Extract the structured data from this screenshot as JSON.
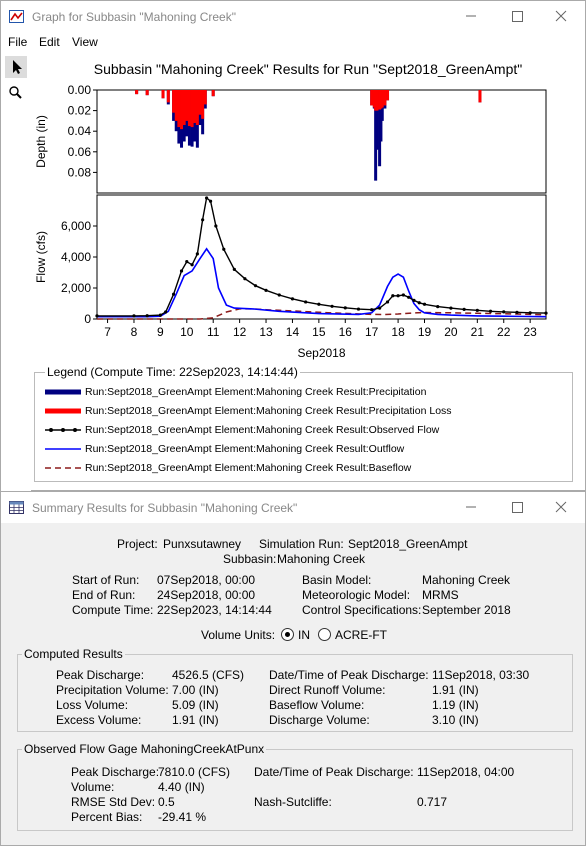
{
  "graph_window": {
    "title": "Graph for Subbasin \"Mahoning Creek\"",
    "menu": [
      "File",
      "Edit",
      "View"
    ],
    "tools": [
      "pointer-tool",
      "zoom-tool"
    ]
  },
  "plot": {
    "title": "Subbasin \"Mahoning Creek\" Results for Run \"Sept2018_GreenAmpt\"",
    "depth_ylabel": "Depth (in)",
    "depth_ticks": [
      "0.00",
      "0.02",
      "0.04",
      "0.06",
      "0.08"
    ],
    "flow_ylabel": "Flow (cfs)",
    "flow_ticks": [
      "0",
      "2,000",
      "4,000",
      "6,000"
    ],
    "x_ticks": [
      "7",
      "8",
      "9",
      "10",
      "11",
      "12",
      "13",
      "14",
      "15",
      "16",
      "17",
      "18",
      "19",
      "20",
      "21",
      "22",
      "23"
    ],
    "x_label": "Sep2018"
  },
  "chart_data": {
    "type": "line",
    "title": "Subbasin \"Mahoning Creek\" Results for Run \"Sept2018_GreenAmpt\"",
    "xlabel": "Sep2018",
    "xlim": [
      6.6,
      23.6
    ],
    "panels": [
      {
        "ylabel": "Depth (in)",
        "ylim": [
          0.0,
          0.1
        ],
        "inverted": true,
        "series": [
          {
            "name": "Run:Sept2018_GreenAmpt Element:Mahoning Creek Result:Precipitation",
            "color": "#000080",
            "x": [
              8.1,
              8.5,
              9.1,
              9.3,
              9.5,
              9.6,
              9.7,
              9.8,
              9.9,
              10.0,
              10.1,
              10.2,
              10.3,
              10.4,
              10.5,
              10.6,
              10.7,
              11.0,
              17.0,
              17.1,
              17.15,
              17.2,
              17.3,
              17.35,
              17.4,
              17.5,
              17.6,
              21.1
            ],
            "values": [
              0.004,
              0.005,
              0.008,
              0.014,
              0.03,
              0.04,
              0.052,
              0.056,
              0.05,
              0.045,
              0.054,
              0.055,
              0.05,
              0.056,
              0.034,
              0.043,
              0.018,
              0.006,
              0.015,
              0.018,
              0.088,
              0.058,
              0.074,
              0.05,
              0.03,
              0.018,
              0.01,
              0.012
            ]
          },
          {
            "name": "Run:Sept2018_GreenAmpt Element:Mahoning Creek Result:Precipitation Loss",
            "color": "#ff0000",
            "x": [
              8.1,
              8.5,
              9.1,
              9.3,
              9.5,
              9.6,
              9.7,
              9.8,
              9.9,
              10.0,
              10.1,
              10.2,
              10.3,
              10.4,
              10.5,
              10.6,
              10.7,
              11.0,
              17.0,
              17.1,
              17.15,
              17.2,
              17.3,
              17.35,
              17.4,
              17.5,
              17.6,
              21.1
            ],
            "values": [
              0.004,
              0.005,
              0.008,
              0.012,
              0.022,
              0.03,
              0.036,
              0.038,
              0.034,
              0.03,
              0.035,
              0.036,
              0.032,
              0.034,
              0.024,
              0.028,
              0.014,
              0.006,
              0.015,
              0.017,
              0.02,
              0.02,
              0.019,
              0.018,
              0.017,
              0.015,
              0.01,
              0.012
            ]
          }
        ]
      },
      {
        "ylabel": "Flow (cfs)",
        "ylim": [
          0,
          8000
        ],
        "series": [
          {
            "name": "Run:Sept2018_GreenAmpt Element:Mahoning Creek Result:Observed Flow",
            "color": "#000000",
            "x": [
              6.6,
              8.0,
              8.5,
              9.0,
              9.2,
              9.5,
              9.8,
              10.0,
              10.2,
              10.4,
              10.6,
              10.75,
              10.9,
              11.1,
              11.4,
              11.8,
              12.2,
              12.6,
              13.0,
              13.5,
              14.0,
              14.5,
              15.0,
              15.5,
              16.0,
              16.5,
              17.0,
              17.3,
              17.6,
              17.8,
              18.0,
              18.2,
              18.4,
              18.6,
              18.8,
              19.0,
              19.5,
              20.0,
              20.5,
              21.0,
              21.5,
              22.0,
              22.5,
              23.0,
              23.6
            ],
            "values": [
              200,
              200,
              210,
              250,
              450,
              1600,
              3100,
              3700,
              3500,
              4200,
              6400,
              7810,
              7600,
              6000,
              4500,
              3200,
              2600,
              2150,
              1850,
              1550,
              1300,
              1100,
              950,
              820,
              720,
              640,
              600,
              700,
              1100,
              1500,
              1500,
              1550,
              1400,
              1200,
              1050,
              950,
              800,
              700,
              620,
              560,
              500,
              460,
              430,
              400,
              380
            ]
          },
          {
            "name": "Run:Sept2018_GreenAmpt Element:Mahoning Creek Result:Outflow",
            "color": "#0000ff",
            "x": [
              6.6,
              8.5,
              9.0,
              9.3,
              9.6,
              9.9,
              10.2,
              10.5,
              10.75,
              11.0,
              11.2,
              11.5,
              11.8,
              12.5,
              13.5,
              15.0,
              16.5,
              17.0,
              17.3,
              17.6,
              17.8,
              18.0,
              18.2,
              18.4,
              18.6,
              18.8,
              19.0,
              19.5,
              20.0,
              21.0,
              22.0,
              23.0,
              23.6
            ],
            "values": [
              150,
              150,
              180,
              500,
              1600,
              2800,
              3100,
              3900,
              4526,
              3900,
              2000,
              900,
              700,
              650,
              500,
              350,
              300,
              400,
              900,
              2100,
              2700,
              2900,
              2700,
              1800,
              1000,
              600,
              400,
              300,
              250,
              200,
              180,
              160,
              150
            ]
          },
          {
            "name": "Run:Sept2018_GreenAmpt Element:Mahoning Creek Result:Baseflow",
            "color": "#8b1a1a",
            "x": [
              6.6,
              10.5,
              11.0,
              11.5,
              12.0,
              12.5,
              13.0,
              14.0,
              15.0,
              16.0,
              17.0,
              17.5,
              18.0,
              18.5,
              19.0,
              20.0,
              21.0,
              22.0,
              23.0,
              23.6
            ],
            "values": [
              0,
              0,
              80,
              450,
              650,
              650,
              600,
              520,
              430,
              360,
              300,
              290,
              320,
              380,
              420,
              400,
              370,
              340,
              300,
              280
            ]
          }
        ]
      }
    ],
    "depth_ticks": [
      0.0,
      0.02,
      0.04,
      0.06,
      0.08
    ],
    "flow_ticks": [
      0,
      2000,
      4000,
      6000
    ],
    "x_ticks": [
      7,
      8,
      9,
      10,
      11,
      12,
      13,
      14,
      15,
      16,
      17,
      18,
      19,
      20,
      21,
      22,
      23
    ],
    "grid": false
  },
  "legend": {
    "title": "Legend (Compute Time: 22Sep2023, 14:14:44)",
    "items": [
      {
        "label": "Run:Sept2018_GreenAmpt Element:Mahoning Creek Result:Precipitation",
        "color": "#000080",
        "style": "thick"
      },
      {
        "label": "Run:Sept2018_GreenAmpt Element:Mahoning Creek Result:Precipitation Loss",
        "color": "#ff0000",
        "style": "thick"
      },
      {
        "label": "Run:Sept2018_GreenAmpt Element:Mahoning Creek Result:Observed Flow",
        "color": "#000000",
        "style": "marker"
      },
      {
        "label": "Run:Sept2018_GreenAmpt Element:Mahoning Creek Result:Outflow",
        "color": "#0000ff",
        "style": "solid"
      },
      {
        "label": "Run:Sept2018_GreenAmpt Element:Mahoning Creek Result:Baseflow",
        "color": "#8b1a1a",
        "style": "dashed"
      }
    ]
  },
  "summary_window": {
    "title": "Summary Results for Subbasin \"Mahoning Creek\"",
    "project_label": "Project:",
    "project_value": "Punxsutawney",
    "sim_run_label": "Simulation Run:",
    "sim_run_value": "Sept2018_GreenAmpt",
    "subbasin_label": "Subbasin:",
    "subbasin_value": "Mahoning Creek",
    "start_label": "Start of Run:",
    "start_value": "07Sep2018, 00:00",
    "end_label": "End of Run:",
    "end_value": "24Sep2018, 00:00",
    "compute_label": "Compute Time:",
    "compute_value": "22Sep2023, 14:14:44",
    "basin_label": "Basin Model:",
    "basin_value": "Mahoning Creek",
    "met_label": "Meteorologic Model:",
    "met_value": "MRMS",
    "control_label": "Control Specifications:",
    "control_value": "September 2018",
    "volume_units_label": "Volume Units:",
    "unit_in": "IN",
    "unit_acre_ft": "ACRE-FT",
    "selected_unit": "IN",
    "computed": {
      "label": "Computed Results",
      "peak_discharge_label": "Peak Discharge:",
      "peak_discharge_value": "4526.5 (CFS)",
      "precip_vol_label": "Precipitation Volume:",
      "precip_vol_value": "7.00 (IN)",
      "loss_vol_label": "Loss Volume:",
      "loss_vol_value": "5.09 (IN)",
      "excess_vol_label": "Excess Volume:",
      "excess_vol_value": "1.91 (IN)",
      "peak_time_label": "Date/Time of Peak Discharge:",
      "peak_time_value": "11Sep2018, 03:30",
      "direct_runoff_label": "Direct Runoff Volume:",
      "direct_runoff_value": "1.91 (IN)",
      "baseflow_vol_label": "Baseflow Volume:",
      "baseflow_vol_value": "1.19 (IN)",
      "discharge_vol_label": "Discharge Volume:",
      "discharge_vol_value": "3.10 (IN)"
    },
    "observed": {
      "label": "Observed Flow Gage MahoningCreekAtPunx",
      "peak_discharge_label": "Peak Discharge:",
      "peak_discharge_value": "7810.0 (CFS)",
      "volume_label": "Volume:",
      "volume_value": "4.40 (IN)",
      "rmse_label": "RMSE Std Dev:",
      "rmse_value": "0.5",
      "bias_label": "Percent Bias:",
      "bias_value": "-29.41 %",
      "peak_time_label": "Date/Time of Peak Discharge:",
      "peak_time_value": "11Sep2018, 04:00",
      "nash_label": "Nash-Sutcliffe:",
      "nash_value": "0.717"
    }
  }
}
